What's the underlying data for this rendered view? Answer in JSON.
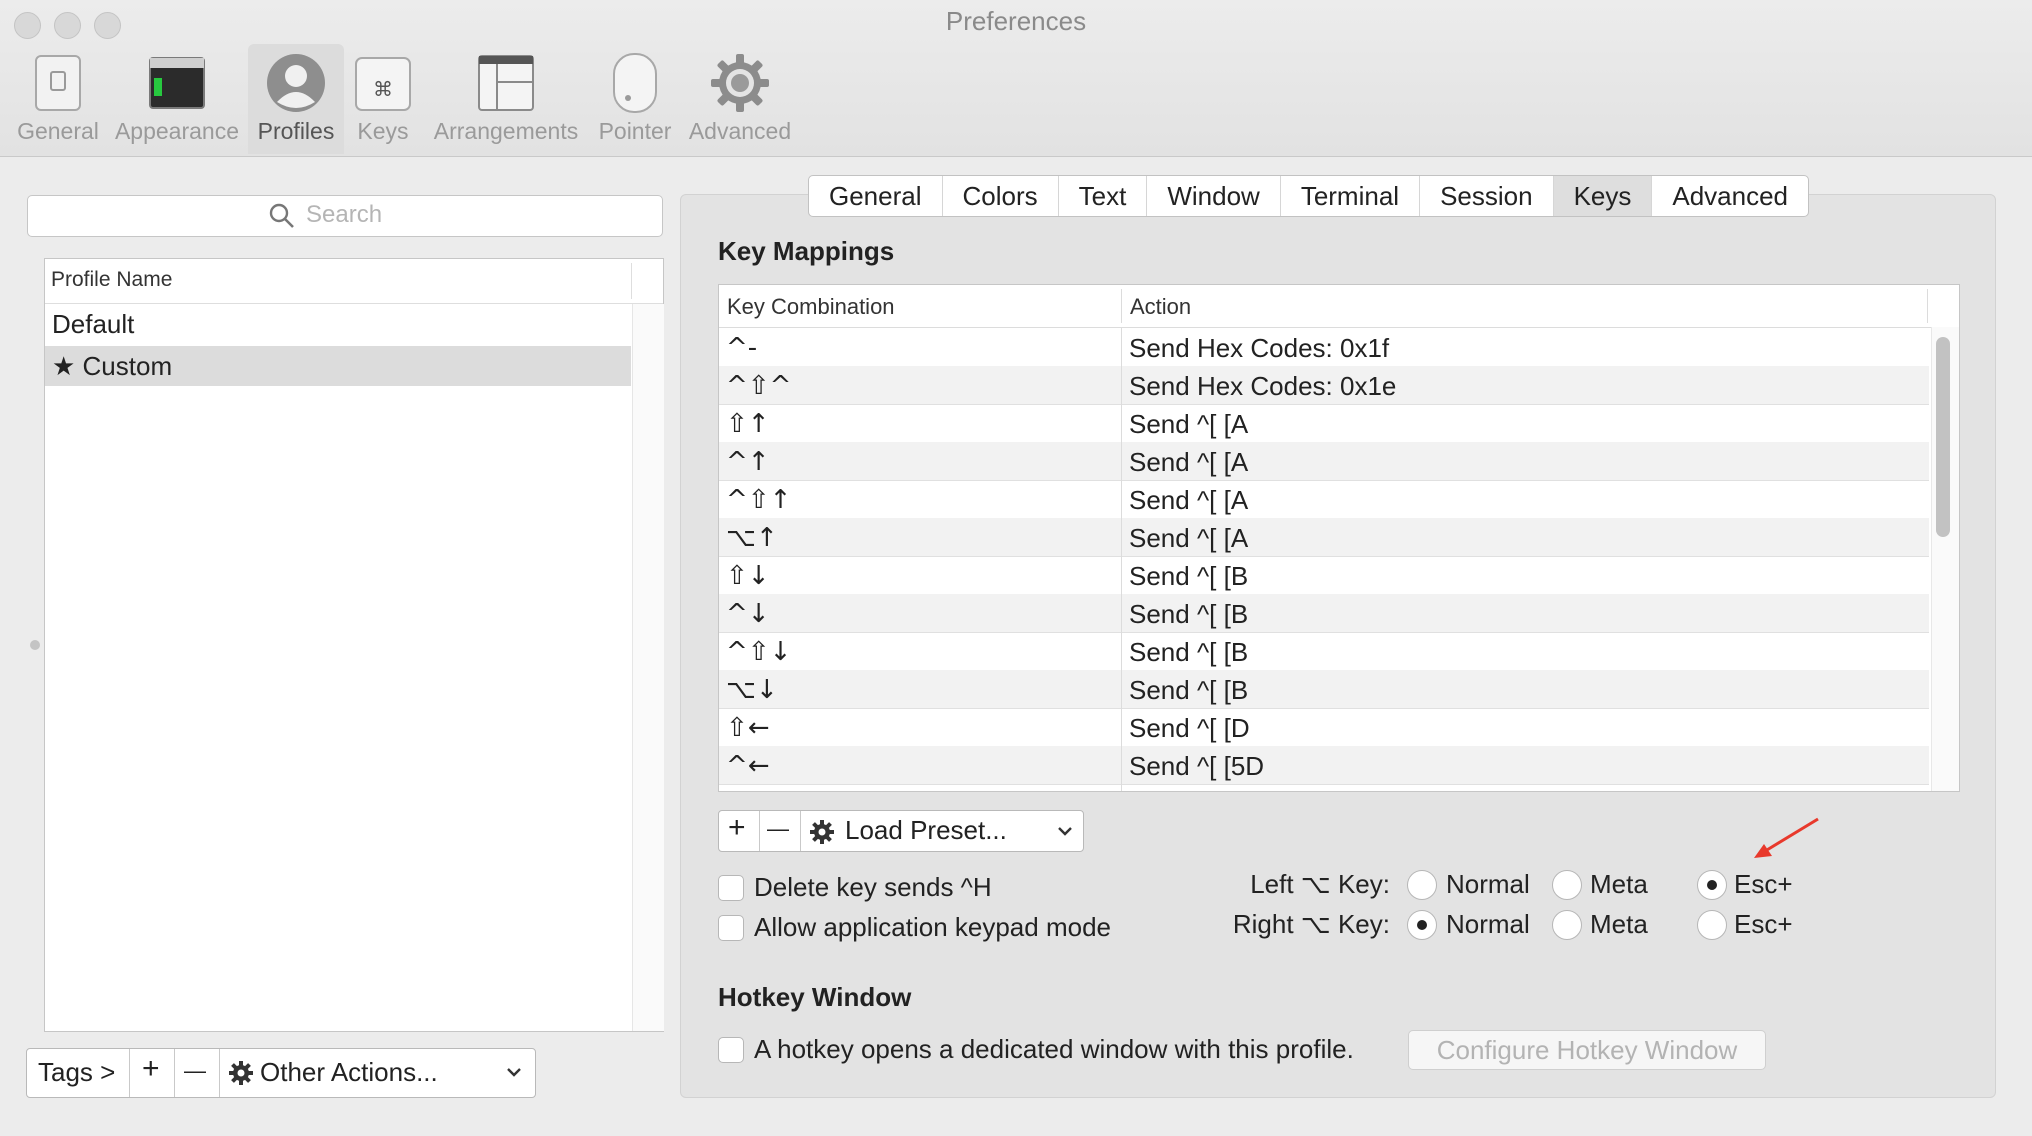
{
  "window": {
    "title": "Preferences"
  },
  "toolbar": {
    "items": [
      {
        "label": "General",
        "icon": "general-icon"
      },
      {
        "label": "Appearance",
        "icon": "appearance-icon"
      },
      {
        "label": "Profiles",
        "icon": "profiles-icon",
        "active": true
      },
      {
        "label": "Keys",
        "icon": "keys-icon"
      },
      {
        "label": "Arrangements",
        "icon": "arrangements-icon"
      },
      {
        "label": "Pointer",
        "icon": "pointer-icon"
      },
      {
        "label": "Advanced",
        "icon": "advanced-gear-icon"
      }
    ]
  },
  "profiles": {
    "search_placeholder": "Search",
    "column_header": "Profile Name",
    "rows": [
      {
        "name": "Default",
        "selected": false
      },
      {
        "name": "★ Custom",
        "selected": true
      }
    ],
    "bottom_bar": {
      "tags": "Tags >",
      "add": "+",
      "remove": "—",
      "other_actions": "Other Actions..."
    }
  },
  "profile_tabs": [
    "General",
    "Colors",
    "Text",
    "Window",
    "Terminal",
    "Session",
    "Keys",
    "Advanced"
  ],
  "active_profile_tab": "Keys",
  "key_mappings": {
    "title": "Key Mappings",
    "columns": [
      "Key Combination",
      "Action"
    ],
    "rows": [
      {
        "key": "^-",
        "action": "Send Hex Codes: 0x1f"
      },
      {
        "key": "^⇧^",
        "action": "Send Hex Codes: 0x1e"
      },
      {
        "key": "⇧↑",
        "action": "Send ^[ [A"
      },
      {
        "key": "^↑",
        "action": "Send ^[ [A"
      },
      {
        "key": "^⇧↑",
        "action": "Send ^[ [A"
      },
      {
        "key": "⌥↑",
        "action": "Send ^[ [A"
      },
      {
        "key": "⇧↓",
        "action": "Send ^[ [B"
      },
      {
        "key": "^↓",
        "action": "Send ^[ [B"
      },
      {
        "key": "^⇧↓",
        "action": "Send ^[ [B"
      },
      {
        "key": "⌥↓",
        "action": "Send ^[ [B"
      },
      {
        "key": "⇧←",
        "action": "Send ^[ [D"
      },
      {
        "key": "^←",
        "action": "Send ^[ [5D"
      }
    ],
    "controls": {
      "add": "+",
      "remove": "—",
      "load_preset": "Load Preset..."
    }
  },
  "options": {
    "delete_key": {
      "label": "Delete key sends ^H",
      "checked": false
    },
    "keypad_mode": {
      "label": "Allow application keypad mode",
      "checked": false
    },
    "left_option": {
      "label": "Left ⌥ Key:",
      "choices": [
        "Normal",
        "Meta",
        "Esc+"
      ],
      "selected": "Esc+"
    },
    "right_option": {
      "label": "Right ⌥ Key:",
      "choices": [
        "Normal",
        "Meta",
        "Esc+"
      ],
      "selected": "Normal"
    }
  },
  "hotkey": {
    "title": "Hotkey Window",
    "checkbox_label": "A hotkey opens a dedicated window with this profile.",
    "checked": false,
    "configure_button": "Configure Hotkey Window"
  },
  "colors": {
    "annotation_arrow": "#e8392c"
  }
}
